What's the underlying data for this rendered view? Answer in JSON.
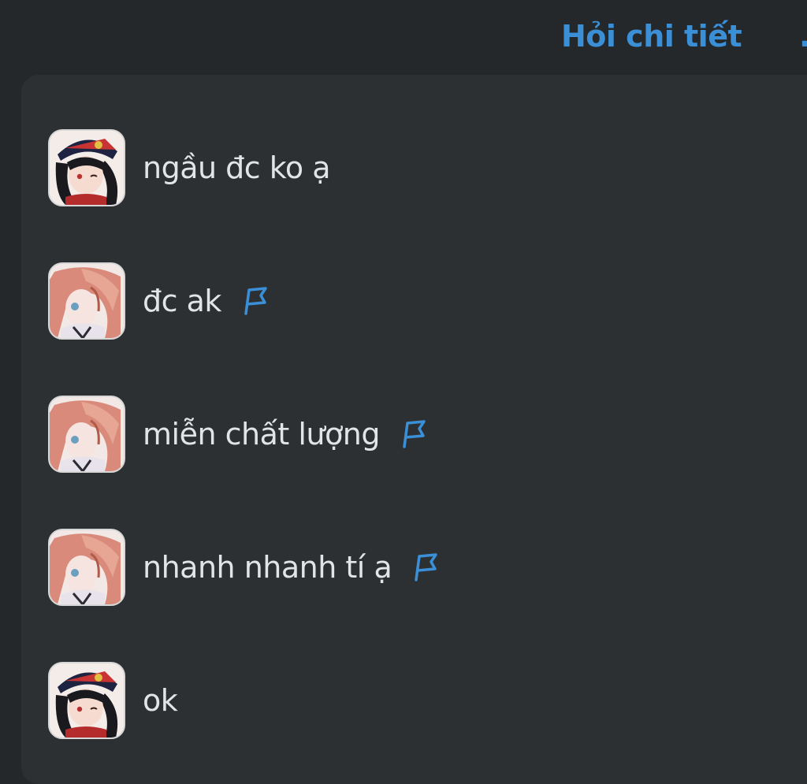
{
  "header": {
    "ask_label": "Hỏi chi tiết",
    "more_label": "..."
  },
  "messages": [
    {
      "text": "ngầu đc ko ạ",
      "avatar": "avatar-black-hair-cap",
      "flagged": false
    },
    {
      "text": "đc ak",
      "avatar": "avatar-pink-hair",
      "flagged": true
    },
    {
      "text": "miễn chất lượng",
      "avatar": "avatar-pink-hair",
      "flagged": true
    },
    {
      "text": "nhanh nhanh tí ạ",
      "avatar": "avatar-pink-hair",
      "flagged": true
    },
    {
      "text": "ok",
      "avatar": "avatar-black-hair-cap",
      "flagged": false
    }
  ],
  "colors": {
    "background": "#25282b",
    "panel": "#2c3033",
    "accent": "#3a8fd6",
    "text": "#e2e4e5"
  }
}
